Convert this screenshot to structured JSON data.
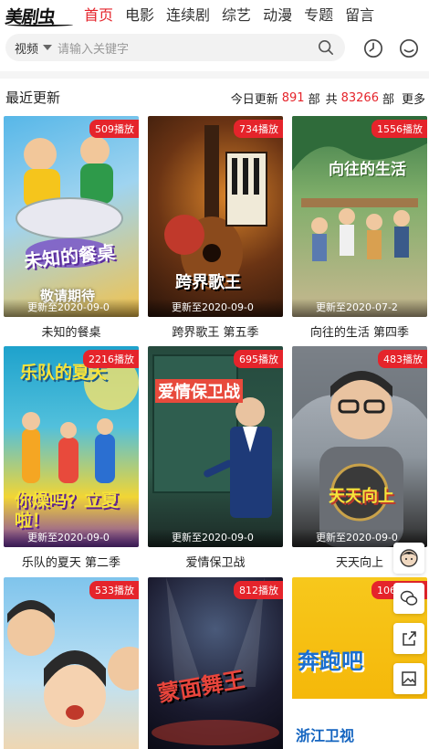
{
  "header": {
    "logo_text": "美剧虫",
    "nav": [
      "首页",
      "电影",
      "连续剧",
      "综艺",
      "动漫",
      "专题",
      "留言"
    ],
    "active_nav": "首页"
  },
  "search": {
    "category": "视频",
    "placeholder": "请输入关键字"
  },
  "section": {
    "title": "最近更新",
    "today_prefix": "今日更新",
    "today_count": "891",
    "unit1": "部",
    "total_prefix": "共",
    "total_count": "83266",
    "unit2": "部",
    "more": "更多"
  },
  "cards": [
    {
      "title": "未知的餐桌",
      "views": "509播放",
      "update": "更新至2020-09-0",
      "poster_text": "敬请期待",
      "poster_logo": "未知的餐桌",
      "colors": [
        "#3aa0d8",
        "#f5c73b"
      ]
    },
    {
      "title": "跨界歌王 第五季",
      "views": "734播放",
      "update": "更新至2020-09-0",
      "poster_text": "跨界歌王",
      "colors": [
        "#3a1f12",
        "#c2601c"
      ]
    },
    {
      "title": "向往的生活 第四季",
      "views": "1556播放",
      "update": "更新至2020-07-2",
      "poster_text": "向往的生活",
      "colors": [
        "#4a8a4c",
        "#c9b58a"
      ]
    },
    {
      "title": "乐队的夏天 第二季",
      "views": "2216播放",
      "update": "更新至2020-09-0",
      "poster_text": "乐队的夏天",
      "poster_sub": "你燥吗？立夏啦！",
      "colors": [
        "#1fa5c8",
        "#f3d630"
      ]
    },
    {
      "title": "爱情保卫战",
      "views": "695播放",
      "update": "更新至2020-09-0",
      "poster_text": "爱情保卫战",
      "colors": [
        "#2e5e4c",
        "#1e2d2a"
      ]
    },
    {
      "title": "天天向上",
      "views": "483播放",
      "update": "更新至2020-09-0",
      "poster_text": "天天向上",
      "colors": [
        "#9aa2ab",
        "#2a2a2a"
      ]
    },
    {
      "title": "",
      "views": "533播放",
      "update": "",
      "colors": [
        "#6bb8e8",
        "#f5d5a0"
      ]
    },
    {
      "title": "",
      "views": "812播放",
      "update": "",
      "poster_text": "蒙面舞王",
      "colors": [
        "#1a1a2e",
        "#c0392b"
      ]
    },
    {
      "title": "",
      "views": "1066播放",
      "update": "",
      "poster_text": "奔跑吧",
      "poster_sub": "浙江卫视",
      "colors": [
        "#f5c518",
        "#1565c0"
      ]
    }
  ],
  "icons": {
    "search": "search-icon",
    "history": "clock-icon",
    "user": "user-icon",
    "float": [
      "avatar-icon",
      "wechat-icon",
      "share-icon",
      "image-icon"
    ]
  },
  "accent": "#e5242b"
}
